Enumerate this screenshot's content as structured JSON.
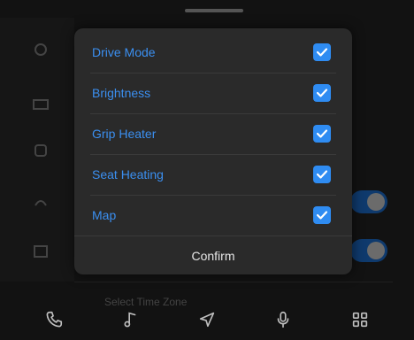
{
  "dialog": {
    "items": [
      {
        "label": "Drive Mode",
        "checked": true
      },
      {
        "label": "Brightness",
        "checked": true
      },
      {
        "label": "Grip Heater",
        "checked": true
      },
      {
        "label": "Seat Heating",
        "checked": true
      },
      {
        "label": "Map",
        "checked": true
      }
    ],
    "confirm_label": "Confirm"
  },
  "background": {
    "footer_text": "Select Time Zone"
  },
  "nav": {
    "items": [
      "phone-icon",
      "music-icon",
      "navigation-icon",
      "microphone-icon",
      "apps-grid-icon"
    ]
  },
  "colors": {
    "accent": "#2f8cf2",
    "item_text": "#3b8ff0",
    "dialog_bg": "#2a2a2a",
    "screen_bg": "#121212"
  }
}
